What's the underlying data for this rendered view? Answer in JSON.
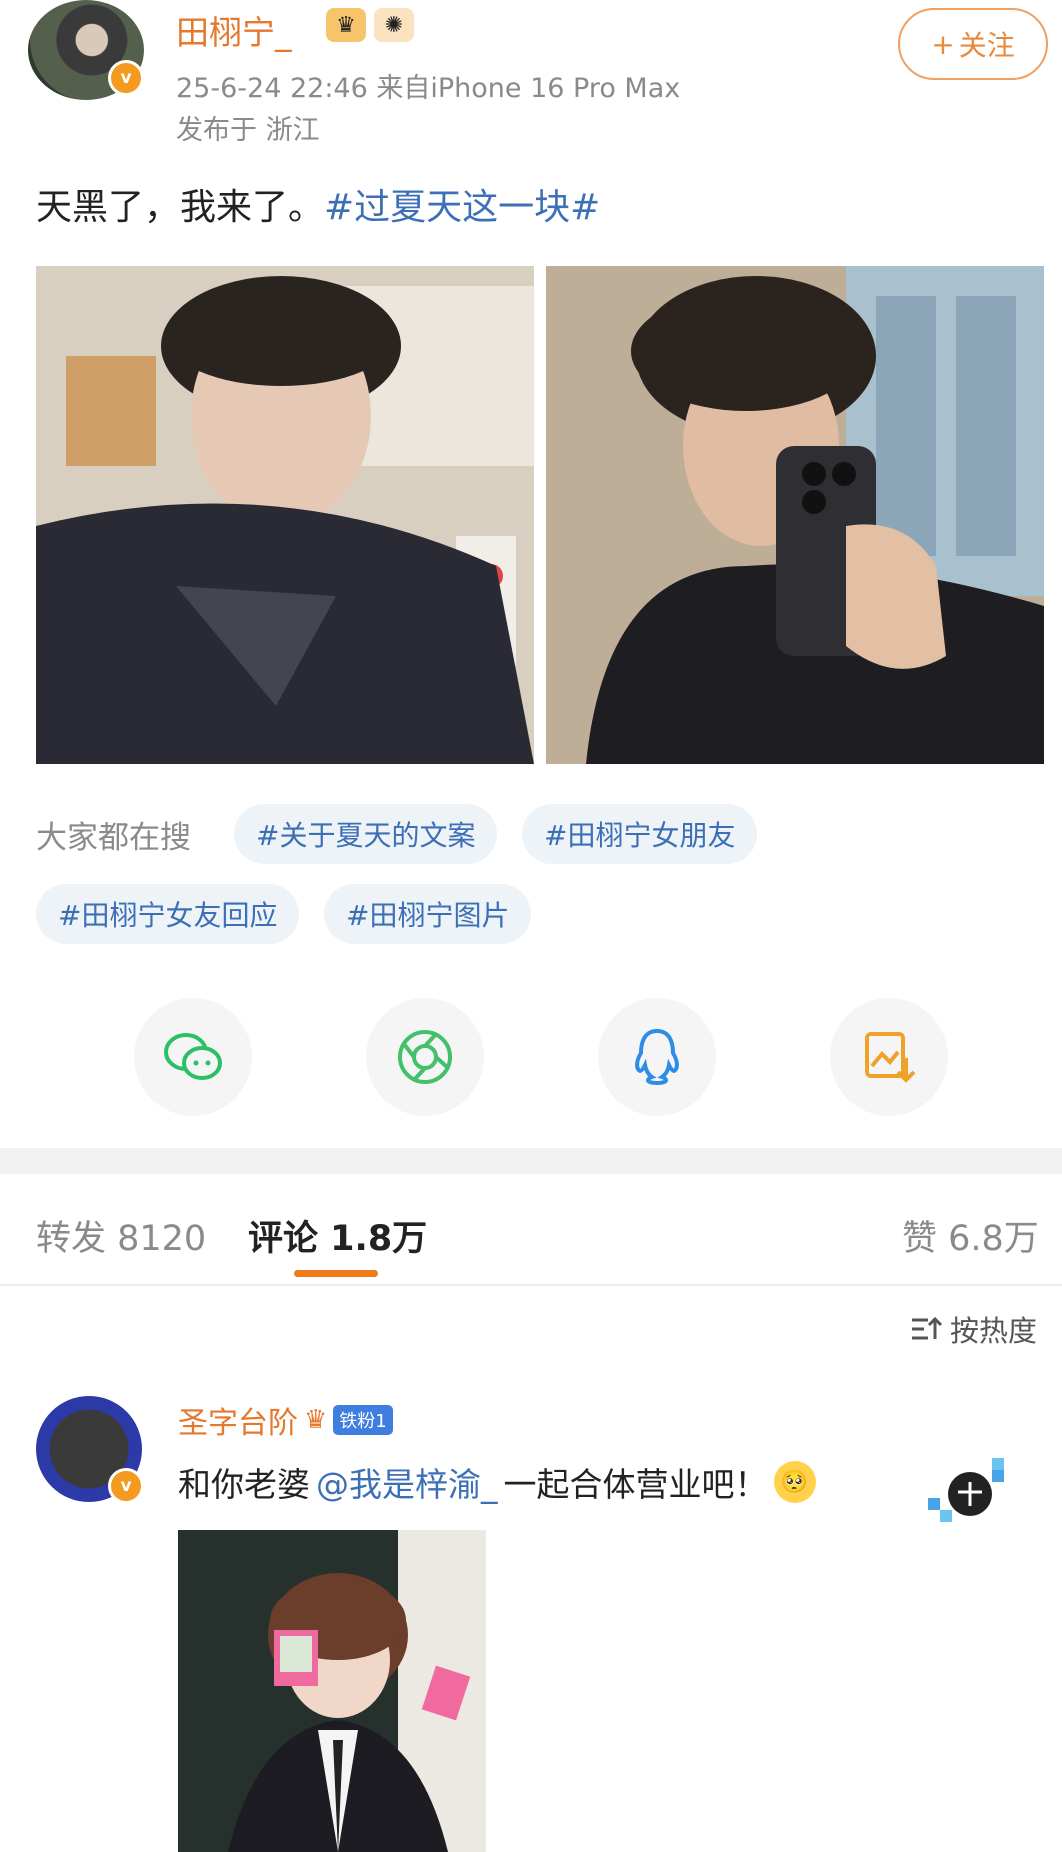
{
  "author": {
    "name": "田栩宁_",
    "time_device": "25-6-24 22:46  来自iPhone 16 Pro Max",
    "location": "发布于 浙江",
    "verified_glyph": "v",
    "follow_label": "关注",
    "follow_plus": "+"
  },
  "post": {
    "text": "天黑了，我来了。",
    "hashtag": "#过夏天这一块#"
  },
  "trending": {
    "label": "大家都在搜",
    "chips": [
      "#关于夏天的文案",
      "#田栩宁女朋友",
      "#田栩宁女友回应",
      "#田栩宁图片"
    ]
  },
  "share_icons": [
    "wechat-icon",
    "moments-icon",
    "qq-icon",
    "save-image-icon"
  ],
  "tabs": {
    "repost": "转发 8120",
    "comments": "评论 1.8万",
    "likes": "赞 6.8万"
  },
  "sort_label": "按热度",
  "comment": {
    "user": "圣字台阶",
    "fan_badge": "铁粉1",
    "text_before": "和你老婆 ",
    "mention": "@我是梓渝_",
    "text_after": " 一起合体营业吧！",
    "verified_glyph": "v"
  },
  "colors": {
    "accent_orange": "#f07a1a",
    "username_orange": "#e5782d",
    "link_blue": "#3d6fb6",
    "muted_gray": "#8a8a8a"
  }
}
